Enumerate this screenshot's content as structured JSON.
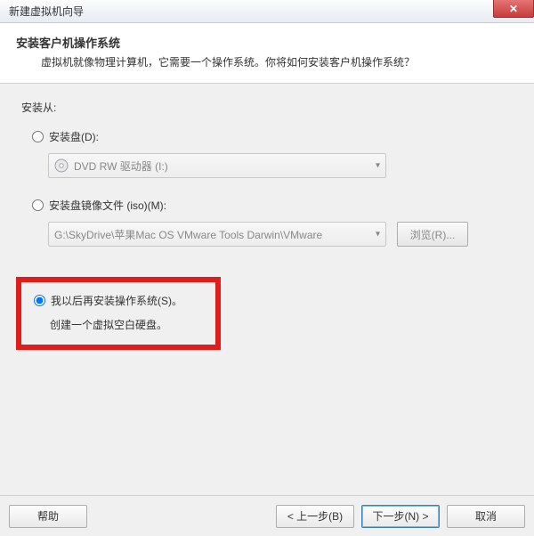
{
  "window": {
    "title": "新建虚拟机向导",
    "close_glyph": "✕"
  },
  "header": {
    "title": "安装客户机操作系统",
    "subtitle": "虚拟机就像物理计算机，它需要一个操作系统。你将如何安装客户机操作系统？"
  },
  "from_label": "安装从:",
  "option_disc": {
    "label": "安装盘(D):",
    "combo_text": "DVD RW 驱动器 (I:)"
  },
  "option_iso": {
    "label": "安装盘镜像文件 (iso)(M):",
    "combo_text": "G:\\SkyDrive\\苹果Mac OS VMware Tools Darwin\\VMware",
    "browse_label": "浏览(R)..."
  },
  "option_later": {
    "label": "我以后再安装操作系统(S)。",
    "sub": "创建一个虚拟空白硬盘。"
  },
  "footer": {
    "help": "帮助",
    "back": "< 上一步(B)",
    "next": "下一步(N) >",
    "cancel": "取消"
  }
}
